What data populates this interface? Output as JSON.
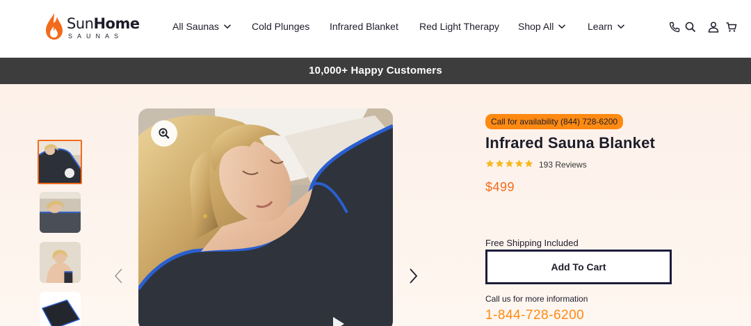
{
  "brand": {
    "logo_name": "SunHome",
    "logo_bold": "Home",
    "logo_light": "Sun",
    "logo_sub": "SAUNAS",
    "flame_color": "#f26b1d"
  },
  "nav": {
    "items": [
      {
        "label": "All Saunas",
        "has_dropdown": true
      },
      {
        "label": "Cold Plunges",
        "has_dropdown": false
      },
      {
        "label": "Infrared Blanket",
        "has_dropdown": false
      },
      {
        "label": "Red Light Therapy",
        "has_dropdown": false
      },
      {
        "label": "Shop All",
        "has_dropdown": true
      },
      {
        "label": "Learn",
        "has_dropdown": true
      }
    ],
    "icons": [
      "phone-icon",
      "search-icon",
      "account-icon",
      "cart-icon"
    ]
  },
  "announcement": {
    "text": "10,000+ Happy Customers",
    "background": "#3d3d3d"
  },
  "gallery": {
    "thumbnails": 4,
    "active_index": 0,
    "icons": [
      "zoom-in-icon",
      "chevron-left-icon",
      "chevron-right-icon"
    ]
  },
  "product": {
    "availability_badge": "Call for availability (844) 728-6200",
    "title": "Infrared Sauna Blanket",
    "rating": 5,
    "reviews_label": "193 Reviews",
    "price": "$499",
    "shipping": "Free Shipping Included",
    "add_to_cart_label": "Add To Cart",
    "call_info": "Call us for more information",
    "phone": "1-844-728-6200"
  },
  "colors": {
    "accent": "#f26b1d",
    "badge": "#fe8a12",
    "text": "#1c1c2a",
    "star": "#f5b71c"
  }
}
